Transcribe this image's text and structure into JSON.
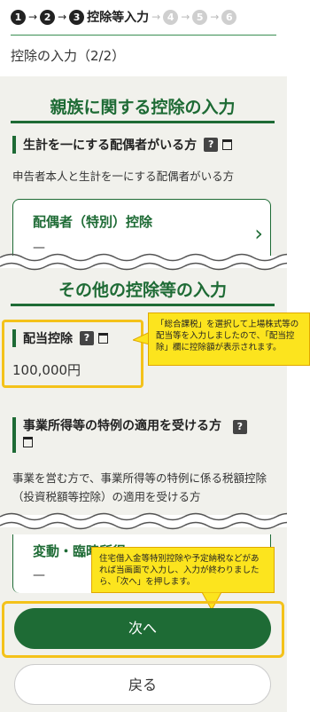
{
  "progress": {
    "current_step": 3,
    "steps": [
      {
        "num": "1",
        "state": "done"
      },
      {
        "num": "2",
        "state": "done"
      },
      {
        "num": "3",
        "state": "current",
        "label": "控除等入力"
      },
      {
        "num": "4",
        "state": "todo"
      },
      {
        "num": "5",
        "state": "todo"
      },
      {
        "num": "6",
        "state": "todo"
      }
    ],
    "arrow": "→"
  },
  "page_title": "控除の入力（2/2）",
  "family_section": {
    "title": "親族に関する控除の入力",
    "spouse_item": {
      "heading": "生計を一にする配偶者がいる方",
      "help": "?",
      "description": "申告者本人と生計を一にする配偶者がいる方",
      "select_label": "配偶者（特別）控除",
      "select_value": "—",
      "chevron": "›"
    }
  },
  "other_section": {
    "title": "その他の控除等の入力",
    "dividend_item": {
      "heading": "配当控除",
      "help": "?",
      "amount": "100,000円"
    },
    "business_item": {
      "heading": "事業所得等の特例の適用を受ける方",
      "help": "?",
      "description": "事業を営む方で、事業所得等の特例に係る税額控除（投資税額等控除）の適用を受ける方"
    },
    "fluctuation_item": {
      "select_label": "変動・臨時所得",
      "select_value": "—"
    }
  },
  "callouts": {
    "dividend_note": "「総合課税」を選択して上場株式等の配当等を入力しましたので、「配当控除」欄に控除額が表示されます。",
    "next_note": "住宅借入金等特別控除や予定納税などがあれば当画面で入力し、入力が終わりましたら、「次へ」を押します。"
  },
  "buttons": {
    "next": "次へ",
    "back": "戻る"
  },
  "colors": {
    "accent": "#1e6b35",
    "highlight": "#f4c21a",
    "callout_bg": "#fce41e"
  }
}
